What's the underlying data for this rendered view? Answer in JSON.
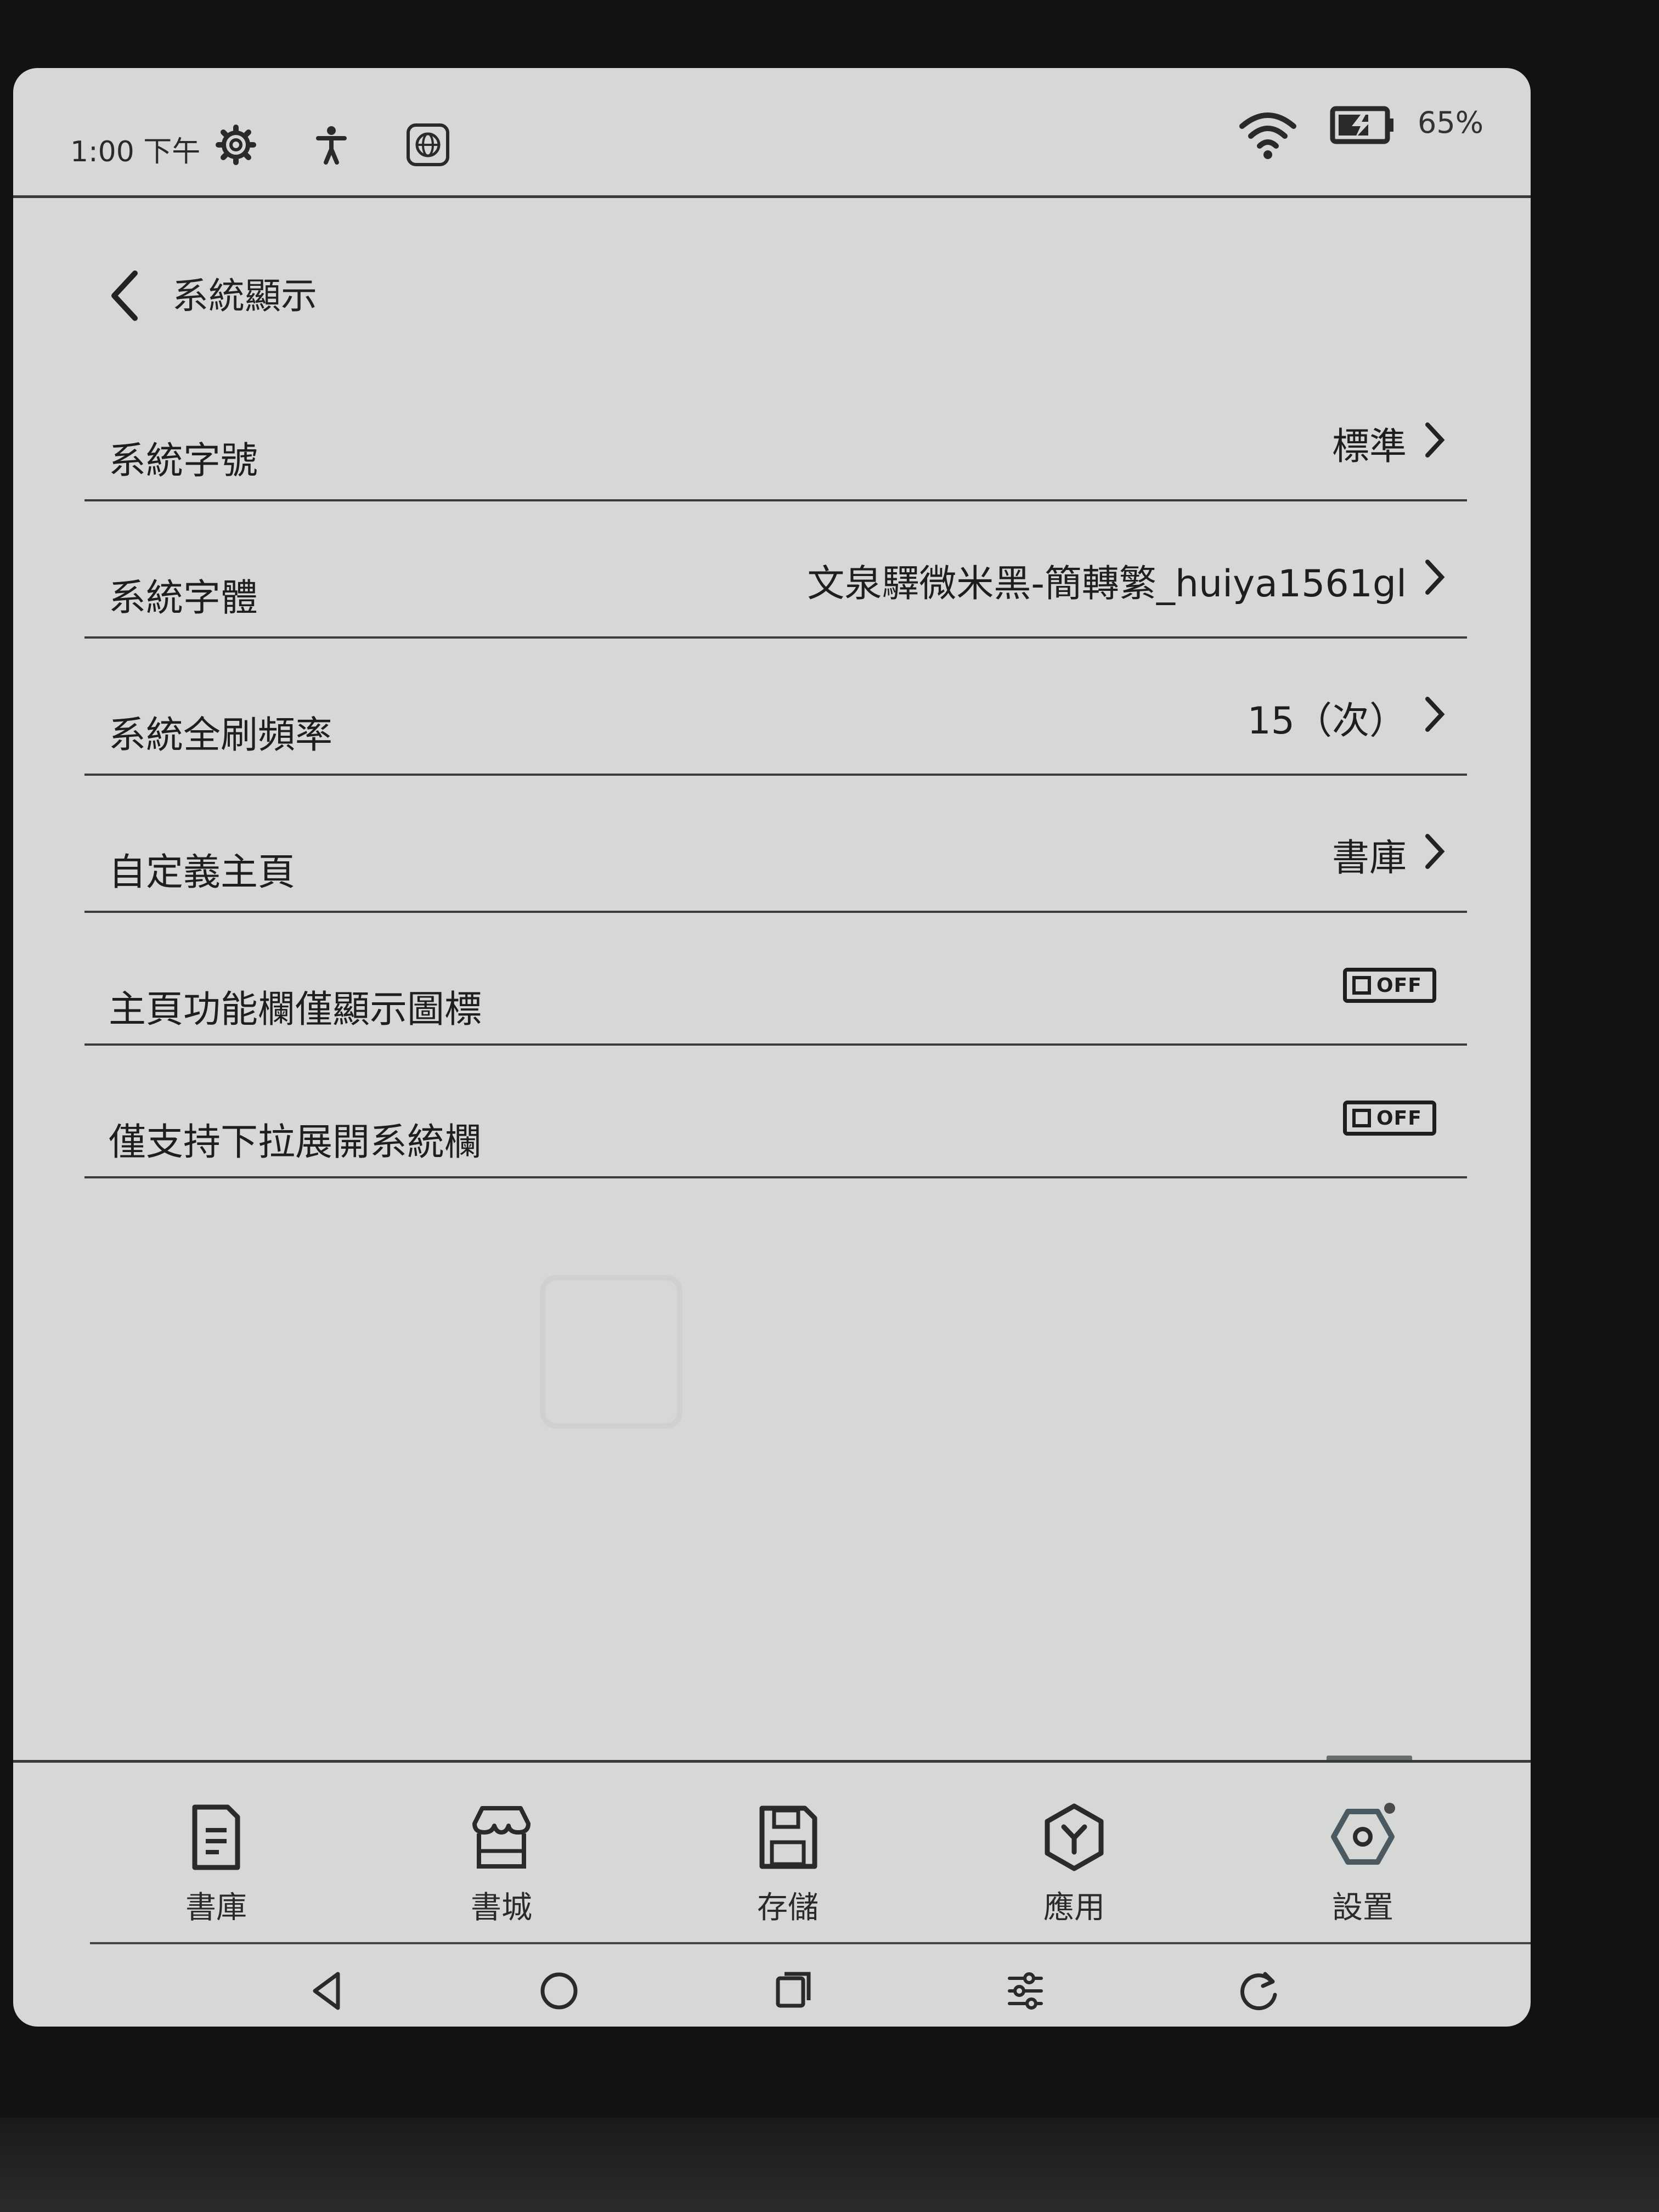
{
  "status_bar": {
    "time": "1:00 下午",
    "battery_percent": "65%",
    "icons": [
      "gear-icon",
      "accessibility-icon",
      "globe-icon",
      "wifi-icon",
      "battery-charging-icon"
    ]
  },
  "header": {
    "title": "系統顯示",
    "back_icon": "chevron-left-icon"
  },
  "settings": [
    {
      "label": "系統字號",
      "value": "標準",
      "type": "link"
    },
    {
      "label": "系統字體",
      "value": "文泉驛微米黑-簡轉繁_huiya1561gl",
      "type": "link"
    },
    {
      "label": "系統全刷頻率",
      "value": "15（次）",
      "type": "link"
    },
    {
      "label": "自定義主頁",
      "value": "書庫",
      "type": "link"
    },
    {
      "label": "主頁功能欄僅顯示圖標",
      "value": "OFF",
      "type": "toggle"
    },
    {
      "label": "僅支持下拉展開系統欄",
      "value": "OFF",
      "type": "toggle"
    }
  ],
  "tabs": [
    {
      "label": "書庫",
      "icon": "library-icon"
    },
    {
      "label": "書城",
      "icon": "store-icon"
    },
    {
      "label": "存儲",
      "icon": "save-icon"
    },
    {
      "label": "應用",
      "icon": "apps-icon"
    },
    {
      "label": "設置",
      "icon": "settings-icon",
      "active": true
    }
  ],
  "nav": [
    "back-icon",
    "home-icon",
    "recents-icon",
    "adjust-icon",
    "refresh-icon"
  ],
  "colors": {
    "screen_bg": "#d6d8d5",
    "ink": "#1e1e1e",
    "bezel": "#121212"
  }
}
